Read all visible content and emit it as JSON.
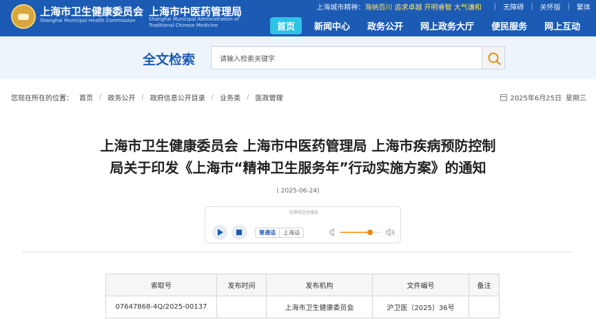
{
  "header": {
    "org1_name": "上海市卫生健康委员会",
    "org1_en": "Shanghai Municipal Health Commission",
    "org2_name": "上海市中医药管理局",
    "org2_en": "Shanghai Municipal Administration of Traditional Chinese Medicine",
    "city_spirit_label": "上海城市精神：",
    "city_spirit_text": "海纳百川 追求卓越 开明睿智 大气谦和",
    "links": [
      "无障碍",
      "关怀版",
      "繁体"
    ],
    "nav": [
      "首页",
      "新闻中心",
      "政务公开",
      "网上政务大厅",
      "便民服务",
      "网上互动"
    ],
    "nav_active": "首页"
  },
  "search": {
    "title": "全文检索",
    "placeholder": "请输入检索关键字"
  },
  "breadcrumb": {
    "prefix": "您现在所在的位置：",
    "items": [
      "首页",
      "政务公开",
      "政府信息公开目录",
      "业务类",
      "医政管理"
    ]
  },
  "today": {
    "date": "2025年6月25日",
    "weekday": "星期三"
  },
  "article": {
    "title_line1": "上海市卫生健康委员会 上海市中医药管理局 上海市疾病预防控制",
    "title_line2": "局关于印发《上海市“精神卫生服务年”行动实施方案》的通知",
    "date": "( 2025-06-24)"
  },
  "player": {
    "caption": "无障碍语音播报",
    "lang_on": "普通话",
    "lang_off": "上海话",
    "volume": 0.72
  },
  "meta_table": {
    "headers": [
      "索取号",
      "发布时间",
      "发布机构",
      "文件编号",
      "备注"
    ],
    "row": [
      "07647868-4Q/2025-00137",
      "",
      "上海市卫生健康委员会",
      "沪卫医〔2025〕36号",
      ""
    ]
  },
  "colors": {
    "brand_blue": "#1c5bb4",
    "nav_active": "#2fc4e5",
    "accent_orange": "#e8890e"
  }
}
